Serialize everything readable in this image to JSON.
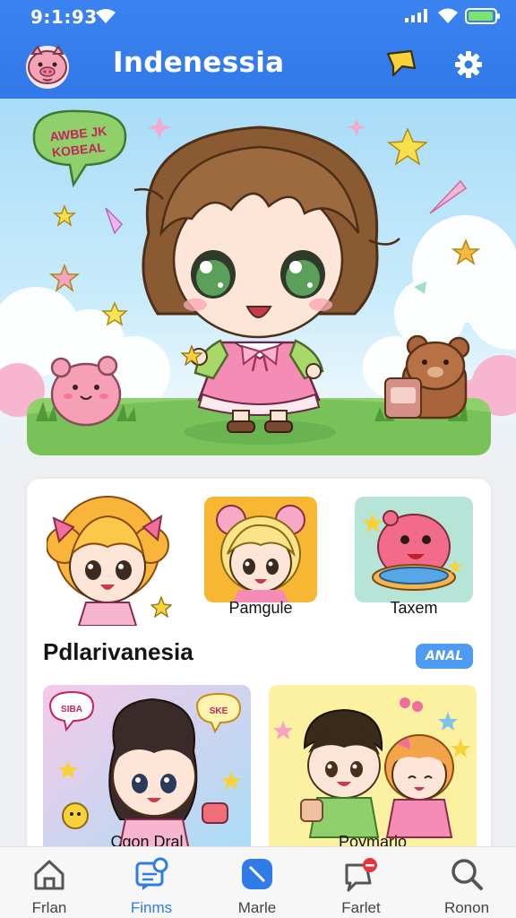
{
  "status_bar": {
    "time": "9:1:93"
  },
  "header": {
    "title": "Indenessia"
  },
  "hero": {
    "speech_bubble_text": [
      "AWBE JK",
      "KOBEAL"
    ]
  },
  "featured": [
    {
      "label": ""
    },
    {
      "label": "Pamgule"
    },
    {
      "label": "Taxem"
    }
  ],
  "section": {
    "title": "Pdlarivanesia",
    "more_label": "ANAL"
  },
  "cards": [
    {
      "label": "Cgon Dral",
      "bubble_left": "SIBA",
      "bubble_right": "SKE"
    },
    {
      "label": "Poymario"
    }
  ],
  "nav": {
    "items": [
      {
        "label": "Frlan",
        "icon": "home-icon"
      },
      {
        "label": "Finms",
        "icon": "chat-icon",
        "active": true
      },
      {
        "label": "Marle",
        "icon": "compose-icon"
      },
      {
        "label": "Farlet",
        "icon": "notification-chat-icon"
      },
      {
        "label": "Ronon",
        "icon": "search-icon"
      }
    ]
  },
  "colors": {
    "header_bg": "#3178e8",
    "active_nav": "#2f7be8",
    "pill": "#4d9bf2"
  }
}
